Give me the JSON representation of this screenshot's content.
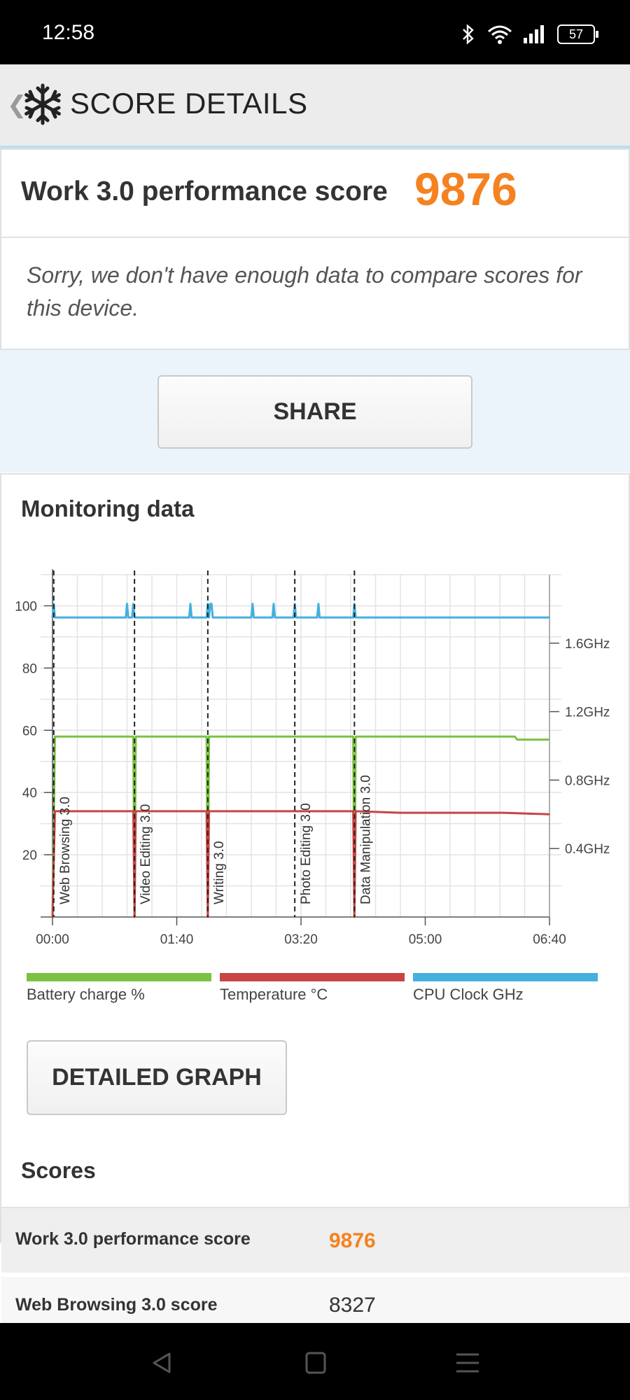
{
  "status_bar": {
    "time": "12:58",
    "battery": "57"
  },
  "app_bar": {
    "back_glyph": "❮",
    "title": "SCORE DETAILS",
    "logo_icon": "snowflake-icon"
  },
  "header": {
    "label": "Work 3.0 performance score",
    "score": "9876",
    "score_color": "#f58220"
  },
  "notice": "Sorry, we don't have enough data to compare scores for this device.",
  "share_label": "SHARE",
  "monitoring": {
    "title": "Monitoring data",
    "legend": [
      {
        "label": "Battery charge %",
        "color": "#7cc142"
      },
      {
        "label": "Temperature °C",
        "color": "#c94444"
      },
      {
        "label": "CPU Clock GHz",
        "color": "#45afe0"
      }
    ]
  },
  "chart_data": {
    "type": "line",
    "xlabel": "",
    "ylabel": "",
    "x_tick_labels": [
      "00:00",
      "01:40",
      "03:20",
      "05:00",
      "06:40"
    ],
    "x_range_seconds": [
      0,
      420
    ],
    "y_ticks": [
      20,
      40,
      60,
      80,
      100
    ],
    "ylim": [
      0,
      110
    ],
    "y2_ticks": [
      "0.4GHz",
      "0.8GHz",
      "1.2GHz",
      "1.6GHz"
    ],
    "y2lim_ghz": [
      0,
      2.0
    ],
    "grid": true,
    "test_markers": [
      {
        "label": "Web Browsing 3.0",
        "t": 1
      },
      {
        "label": "Video Editing 3.0",
        "t": 66
      },
      {
        "label": "Writing 3.0",
        "t": 125
      },
      {
        "label": "Photo Editing 3.0",
        "t": 195
      },
      {
        "label": "Data Manipulation 3.0",
        "t": 243
      }
    ],
    "series": [
      {
        "name": "Battery charge %",
        "color": "#7cc142",
        "x": [
          0,
          2,
          65,
          66,
          67,
          124,
          125,
          126,
          242,
          243,
          244,
          372,
          374,
          400
        ],
        "values": [
          0,
          58,
          58,
          0,
          58,
          58,
          0,
          58,
          58,
          0,
          58,
          58,
          57,
          57
        ]
      },
      {
        "name": "Temperature °C",
        "color": "#c94444",
        "x": [
          0,
          2,
          65,
          66,
          67,
          124,
          125,
          126,
          195,
          242,
          243,
          244,
          280,
          363,
          400
        ],
        "values": [
          0,
          34,
          34,
          0,
          34,
          34,
          0,
          34,
          34,
          34,
          0,
          34,
          33.5,
          33.5,
          33
        ]
      },
      {
        "name": "CPU Clock GHz",
        "color": "#45afe0",
        "x": [
          0,
          1,
          2,
          3,
          59,
          60,
          61,
          64,
          65,
          66,
          67,
          110,
          111,
          112,
          124,
          125,
          126,
          127,
          128,
          129,
          130,
          131,
          160,
          161,
          162,
          177,
          178,
          179,
          194,
          195,
          196,
          213,
          214,
          215,
          242,
          243,
          244,
          245,
          400
        ],
        "values": [
          1.75,
          1.83,
          1.75,
          1.75,
          1.75,
          1.83,
          1.75,
          1.75,
          1.83,
          1.75,
          1.75,
          1.75,
          1.83,
          1.75,
          1.75,
          1.83,
          1.75,
          1.83,
          1.83,
          1.75,
          1.75,
          1.75,
          1.75,
          1.83,
          1.75,
          1.75,
          1.83,
          1.75,
          1.75,
          1.83,
          1.75,
          1.75,
          1.83,
          1.75,
          1.75,
          1.83,
          1.75,
          1.75,
          1.75
        ]
      }
    ]
  },
  "detailed_graph_label": "DETAILED GRAPH",
  "scores": {
    "title": "Scores",
    "rows": [
      {
        "name": "Work 3.0 performance score",
        "value": "9876",
        "highlight": true
      },
      {
        "name": "Web Browsing 3.0 score",
        "value": "8327",
        "highlight": false
      }
    ]
  }
}
